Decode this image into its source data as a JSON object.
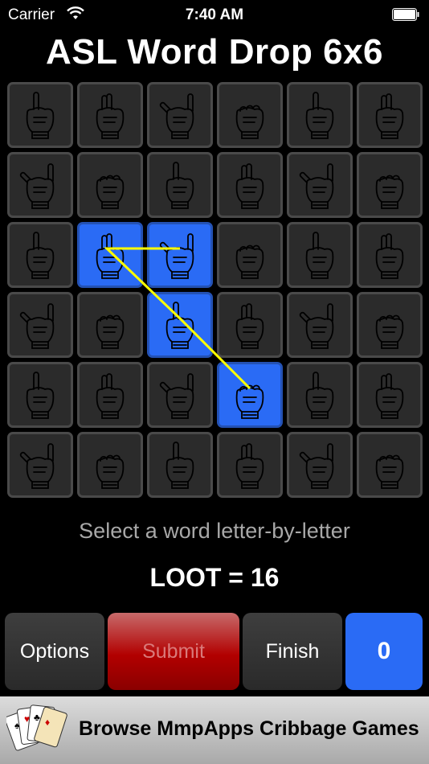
{
  "status_bar": {
    "carrier": "Carrier",
    "time": "7:40 AM",
    "wifi_icon": "wifi-icon",
    "battery_icon": "battery-icon"
  },
  "title": "ASL Word Drop 6x6",
  "board": {
    "rows": 6,
    "cols": 6,
    "tiles": [
      [
        "Y",
        "A",
        "D",
        "D",
        "R",
        "I"
      ],
      [
        "S",
        "A",
        "A",
        "E",
        "S",
        "H"
      ],
      [
        "C",
        "L",
        "O",
        "M",
        "N",
        "W"
      ],
      [
        "T",
        "C",
        "O",
        "Y",
        "C",
        "F"
      ],
      [
        "T",
        "S",
        "I",
        "L",
        "G",
        "K"
      ],
      [
        "Y",
        "S",
        "I",
        "I",
        "S",
        "H"
      ]
    ],
    "selected": [
      [
        2,
        1
      ],
      [
        2,
        2
      ],
      [
        3,
        2
      ],
      [
        4,
        3
      ]
    ],
    "selection_path": [
      [
        2,
        1
      ],
      [
        2,
        2
      ],
      [
        2,
        1
      ],
      [
        3,
        2
      ],
      [
        4,
        3
      ]
    ],
    "colors": {
      "tile": "#2b2b2b",
      "tile_border": "#4a4a4a",
      "selected": "#2a6bf5",
      "path": "#ffff00"
    }
  },
  "instruction": "Select a word letter-by-letter",
  "current_word": "LOOT = 16",
  "buttons": {
    "options": "Options",
    "submit": "Submit",
    "finish": "Finish",
    "score": "0"
  },
  "ad": {
    "text": "Browse MmpApps Cribbage Games",
    "icon": "playing-cards-icon"
  }
}
